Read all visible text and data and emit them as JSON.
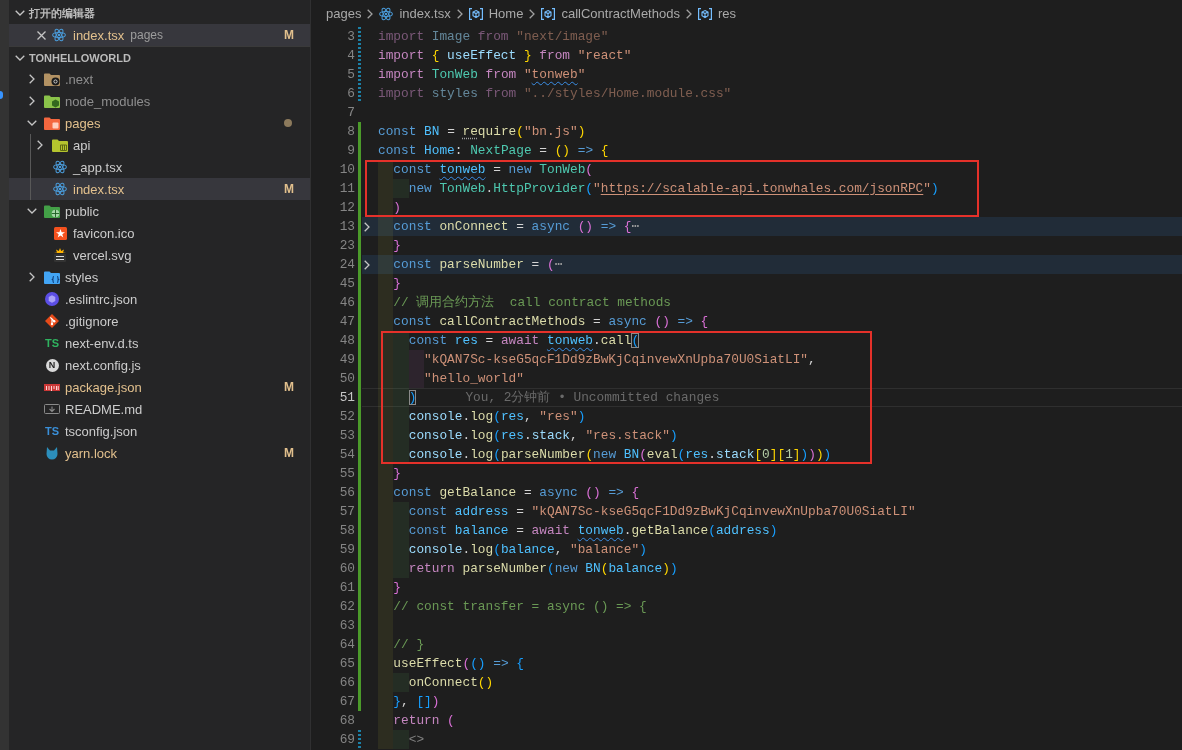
{
  "sidebar": {
    "open_editors": {
      "title": "打开的编辑器",
      "expanded": true,
      "items": [
        {
          "label": "index.tsx",
          "kind": "react",
          "folder": "pages",
          "modified": true,
          "badge": "M",
          "selected": true
        }
      ]
    },
    "explorer": {
      "title": "TONHELLOWORLD",
      "expanded": true,
      "items": [
        {
          "label": ".next",
          "kind": "folder-next",
          "expanded": false,
          "modified": false,
          "ignored": true,
          "changes_inside": false,
          "selected": false
        },
        {
          "label": "node_modules",
          "kind": "folder-node",
          "expanded": false,
          "modified": false,
          "ignored": true,
          "changes_inside": false,
          "selected": false
        },
        {
          "label": "pages",
          "kind": "folder-pages",
          "expanded": true,
          "modified": false,
          "ignored": false,
          "changes_inside": true,
          "selected": false,
          "children": [
            {
              "label": "api",
              "kind": "folder-api",
              "expanded": false,
              "modified": false,
              "ignored": false,
              "changes_inside": false,
              "selected": false
            },
            {
              "label": "_app.tsx",
              "kind": "react",
              "modified": false,
              "ignored": false,
              "selected": false
            },
            {
              "label": "index.tsx",
              "kind": "react",
              "modified": true,
              "ignored": false,
              "badge": "M",
              "selected": true
            }
          ]
        },
        {
          "label": "public",
          "kind": "folder-public",
          "expanded": true,
          "modified": false,
          "ignored": false,
          "changes_inside": false,
          "selected": false,
          "children": [
            {
              "label": "favicon.ico",
              "kind": "favicon",
              "modified": false,
              "ignored": false,
              "selected": false
            },
            {
              "label": "vercel.svg",
              "kind": "svg",
              "modified": false,
              "ignored": false,
              "selected": false
            }
          ]
        },
        {
          "label": "styles",
          "kind": "folder-styles",
          "expanded": false,
          "modified": false,
          "ignored": false,
          "changes_inside": false,
          "selected": false
        },
        {
          "label": ".eslintrc.json",
          "kind": "eslint",
          "modified": false,
          "ignored": false,
          "selected": false
        },
        {
          "label": ".gitignore",
          "kind": "git",
          "modified": false,
          "ignored": false,
          "selected": false
        },
        {
          "label": "next-env.d.ts",
          "kind": "ts",
          "icon_text": "TS",
          "modified": false,
          "ignored": false,
          "selected": false
        },
        {
          "label": "next.config.js",
          "kind": "next",
          "icon_text": "N",
          "modified": false,
          "ignored": false,
          "selected": false
        },
        {
          "label": "package.json",
          "kind": "npm",
          "modified": true,
          "ignored": false,
          "badge": "M",
          "selected": false
        },
        {
          "label": "README.md",
          "kind": "markdown",
          "modified": false,
          "ignored": false,
          "selected": false
        },
        {
          "label": "tsconfig.json",
          "kind": "tsconfig",
          "icon_text": "TS",
          "modified": false,
          "ignored": false,
          "selected": false
        },
        {
          "label": "yarn.lock",
          "kind": "yarn",
          "modified": true,
          "ignored": false,
          "badge": "M",
          "selected": false
        }
      ]
    }
  },
  "editor": {
    "breadcrumbs": [
      {
        "kind": "folder",
        "label": "pages"
      },
      {
        "kind": "react",
        "label": "index.tsx"
      },
      {
        "kind": "symbol",
        "label": "Home"
      },
      {
        "kind": "symbol",
        "label": "callContractMethods"
      },
      {
        "kind": "symbol",
        "label": "res"
      }
    ],
    "code": {
      "lines": [
        {
          "number": "3",
          "kind": "modified",
          "folded": false,
          "current": false,
          "faded": true,
          "boxed": false,
          "tokens": [
            {
              "kind": "keyword",
              "text": "import"
            },
            {
              "kind": "variable",
              "text": " Image"
            },
            {
              "kind": "keyword",
              "text": " from"
            },
            {
              "kind": "string",
              "text": " \"next/image\""
            }
          ]
        },
        {
          "number": "4",
          "kind": "modified",
          "folded": false,
          "current": false,
          "faded": false,
          "boxed": false,
          "tokens": [
            {
              "kind": "keyword",
              "text": "import"
            },
            {
              "kind": "bracket1",
              "text": " {"
            },
            {
              "kind": "variable",
              "text": " useEffect"
            },
            {
              "kind": "bracket1",
              "text": " }"
            },
            {
              "kind": "keyword",
              "text": " from"
            },
            {
              "kind": "string",
              "text": " \"react\""
            }
          ]
        },
        {
          "number": "5",
          "kind": "modified",
          "folded": false,
          "current": false,
          "faded": false,
          "boxed": false,
          "tokens": [
            {
              "kind": "keyword",
              "text": "import"
            },
            {
              "kind": "class",
              "text": " TonWeb"
            },
            {
              "kind": "keyword",
              "text": " from"
            },
            {
              "kind": "string",
              "text": " \""
            },
            {
              "kind": "string",
              "text": "tonweb",
              "squiggly": true
            },
            {
              "kind": "string",
              "text": "\""
            }
          ]
        },
        {
          "number": "6",
          "kind": "modified",
          "folded": false,
          "current": false,
          "faded": true,
          "boxed": false,
          "tokens": [
            {
              "kind": "keyword",
              "text": "import"
            },
            {
              "kind": "variable",
              "text": " styles"
            },
            {
              "kind": "keyword",
              "text": " from"
            },
            {
              "kind": "string",
              "text": " \"../styles/Home.module.css\""
            }
          ]
        },
        {
          "number": "7",
          "kind": "unchanged",
          "folded": false,
          "current": false,
          "boxed": false
        },
        {
          "number": "8",
          "kind": "added",
          "folded": false,
          "current": false,
          "faded": false,
          "boxed": false,
          "tokens": [
            {
              "kind": "storage",
              "text": "const"
            },
            {
              "kind": "constant",
              "text": " BN"
            },
            {
              "kind": "punct",
              "text": " = "
            },
            {
              "kind": "function",
              "text": "re",
              "hint": true
            },
            {
              "kind": "function",
              "text": "quire"
            },
            {
              "kind": "bracket1",
              "text": "("
            },
            {
              "kind": "string",
              "text": "\"bn.js\""
            },
            {
              "kind": "bracket1",
              "text": ")"
            }
          ]
        },
        {
          "number": "9",
          "kind": "added",
          "folded": false,
          "current": false,
          "faded": false,
          "boxed": false,
          "tokens": [
            {
              "kind": "storage",
              "text": "const"
            },
            {
              "kind": "constant",
              "text": " Home"
            },
            {
              "kind": "punct",
              "text": ":"
            },
            {
              "kind": "class",
              "text": " NextPage"
            },
            {
              "kind": "punct",
              "text": " = "
            },
            {
              "kind": "bracket1",
              "text": "("
            },
            {
              "kind": "bracket1",
              "text": ")"
            },
            {
              "kind": "storage",
              "text": " =>"
            },
            {
              "kind": "bracket1",
              "text": " {"
            }
          ],
          "children": [
            {
              "number": "10",
              "kind": "added",
              "folded": false,
              "current": false,
              "faded": false,
              "boxed": true,
              "tokens": [
                {
                  "kind": "storage",
                  "text": "const "
                },
                {
                  "kind": "constant",
                  "text": "tonweb",
                  "squiggly": true
                },
                {
                  "kind": "punct",
                  "text": " = "
                },
                {
                  "kind": "storage",
                  "text": "new"
                },
                {
                  "kind": "class",
                  "text": " TonWeb"
                },
                {
                  "kind": "bracket2",
                  "text": "("
                }
              ],
              "children": [
                {
                  "number": "11",
                  "kind": "added",
                  "folded": false,
                  "current": false,
                  "faded": false,
                  "boxed": true,
                  "tokens": [
                    {
                      "kind": "storage",
                      "text": "new"
                    },
                    {
                      "kind": "class",
                      "text": " TonWeb"
                    },
                    {
                      "kind": "punct",
                      "text": "."
                    },
                    {
                      "kind": "class",
                      "text": "HttpProvider"
                    },
                    {
                      "kind": "bracket3",
                      "text": "("
                    },
                    {
                      "kind": "string",
                      "text": "\""
                    },
                    {
                      "kind": "string",
                      "text": "https://scalable-api.tonwhales.com/jsonRPC",
                      "link": true
                    },
                    {
                      "kind": "string",
                      "text": "\""
                    },
                    {
                      "kind": "bracket3",
                      "text": ")"
                    }
                  ]
                }
              ]
            },
            {
              "number": "12",
              "kind": "added",
              "folded": false,
              "current": false,
              "faded": false,
              "boxed": true,
              "tokens": [
                {
                  "kind": "bracket2",
                  "text": ")"
                }
              ]
            },
            {
              "number": "13",
              "kind": "added",
              "folded": true,
              "current": false,
              "faded": false,
              "boxed": false,
              "tokens": [
                {
                  "kind": "storage",
                  "text": "const"
                },
                {
                  "kind": "function",
                  "text": " onConnect"
                },
                {
                  "kind": "punct",
                  "text": " = "
                },
                {
                  "kind": "storage",
                  "text": "async"
                },
                {
                  "kind": "bracket2",
                  "text": " ("
                },
                {
                  "kind": "bracket2",
                  "text": ")"
                },
                {
                  "kind": "storage",
                  "text": " =>"
                },
                {
                  "kind": "bracket2",
                  "text": " {"
                },
                {
                  "kind": "fold",
                  "text": "⋯"
                }
              ]
            },
            {
              "number": "23",
              "kind": "added",
              "folded": false,
              "current": false,
              "faded": false,
              "boxed": false,
              "tokens": [
                {
                  "kind": "bracket2",
                  "text": "}"
                }
              ]
            },
            {
              "number": "24",
              "kind": "added",
              "folded": true,
              "current": false,
              "faded": false,
              "boxed": false,
              "tokens": [
                {
                  "kind": "storage",
                  "text": "const"
                },
                {
                  "kind": "function",
                  "text": " parseNumber"
                },
                {
                  "kind": "punct",
                  "text": " = "
                },
                {
                  "kind": "bracket2",
                  "text": "("
                },
                {
                  "kind": "fold",
                  "text": "⋯"
                }
              ]
            },
            {
              "number": "45",
              "kind": "added",
              "folded": false,
              "current": false,
              "faded": false,
              "boxed": false,
              "tokens": [
                {
                  "kind": "bracket2",
                  "text": "}"
                }
              ]
            },
            {
              "number": "46",
              "kind": "added",
              "folded": false,
              "current": false,
              "faded": false,
              "boxed": false,
              "tokens": [
                {
                  "kind": "comment",
                  "text": "// 调用合约方法  call contract methods"
                }
              ]
            },
            {
              "number": "47",
              "kind": "added",
              "folded": false,
              "current": false,
              "faded": false,
              "boxed": false,
              "tokens": [
                {
                  "kind": "storage",
                  "text": "const"
                },
                {
                  "kind": "function",
                  "text": " callContractMethods"
                },
                {
                  "kind": "punct",
                  "text": " = "
                },
                {
                  "kind": "storage",
                  "text": "async"
                },
                {
                  "kind": "bracket2",
                  "text": " ("
                },
                {
                  "kind": "bracket2",
                  "text": ")"
                },
                {
                  "kind": "storage",
                  "text": " =>"
                },
                {
                  "kind": "bracket2",
                  "text": " {"
                }
              ],
              "children": [
                {
                  "number": "48",
                  "kind": "added",
                  "folded": false,
                  "current": false,
                  "faded": false,
                  "boxed": true,
                  "tokens": [
                    {
                      "kind": "storage",
                      "text": "const "
                    },
                    {
                      "kind": "constant",
                      "text": "res"
                    },
                    {
                      "kind": "punct",
                      "text": " = "
                    },
                    {
                      "kind": "keyword",
                      "text": "await "
                    },
                    {
                      "kind": "constant",
                      "text": "tonweb",
                      "squiggly": true
                    },
                    {
                      "kind": "punct",
                      "text": "."
                    },
                    {
                      "kind": "function",
                      "text": "call"
                    },
                    {
                      "kind": "bracket3",
                      "text": "(",
                      "matched": true
                    }
                  ],
                  "children": [
                    {
                      "number": "49",
                      "kind": "added",
                      "folded": false,
                      "current": false,
                      "faded": false,
                      "boxed": true,
                      "tokens": [
                        {
                          "kind": "string",
                          "text": "\"kQAN7Sc-kseG5qcF1Dd9zBwKjCqinvewXnUpba70U0SiatLI\""
                        },
                        {
                          "kind": "punct",
                          "text": ","
                        }
                      ]
                    },
                    {
                      "number": "50",
                      "kind": "added",
                      "folded": false,
                      "current": false,
                      "faded": false,
                      "boxed": true,
                      "tokens": [
                        {
                          "kind": "string",
                          "text": "\"hello_world\""
                        }
                      ]
                    }
                  ]
                },
                {
                  "number": "51",
                  "kind": "added",
                  "folded": false,
                  "current": true,
                  "faded": false,
                  "boxed": true,
                  "blame": "You, 2分钟前 • Uncommitted changes",
                  "tokens": [
                    {
                      "kind": "bracket3",
                      "text": ")",
                      "matched": true
                    }
                  ]
                },
                {
                  "number": "52",
                  "kind": "added",
                  "folded": false,
                  "current": false,
                  "faded": false,
                  "boxed": true,
                  "tokens": [
                    {
                      "kind": "variable",
                      "text": "console"
                    },
                    {
                      "kind": "punct",
                      "text": "."
                    },
                    {
                      "kind": "function",
                      "text": "log"
                    },
                    {
                      "kind": "bracket3",
                      "text": "("
                    },
                    {
                      "kind": "constant",
                      "text": "res"
                    },
                    {
                      "kind": "punct",
                      "text": ", "
                    },
                    {
                      "kind": "string",
                      "text": "\"res\""
                    },
                    {
                      "kind": "bracket3",
                      "text": ")"
                    }
                  ]
                },
                {
                  "number": "53",
                  "kind": "added",
                  "folded": false,
                  "current": false,
                  "faded": false,
                  "boxed": true,
                  "tokens": [
                    {
                      "kind": "variable",
                      "text": "console"
                    },
                    {
                      "kind": "punct",
                      "text": "."
                    },
                    {
                      "kind": "function",
                      "text": "log"
                    },
                    {
                      "kind": "bracket3",
                      "text": "("
                    },
                    {
                      "kind": "constant",
                      "text": "res"
                    },
                    {
                      "kind": "punct",
                      "text": "."
                    },
                    {
                      "kind": "variable",
                      "text": "stack"
                    },
                    {
                      "kind": "punct",
                      "text": ", "
                    },
                    {
                      "kind": "string",
                      "text": "\"res.stack\""
                    },
                    {
                      "kind": "bracket3",
                      "text": ")"
                    }
                  ]
                },
                {
                  "number": "54",
                  "kind": "added",
                  "folded": false,
                  "current": false,
                  "faded": false,
                  "boxed": true,
                  "tokens": [
                    {
                      "kind": "variable",
                      "text": "console"
                    },
                    {
                      "kind": "punct",
                      "text": "."
                    },
                    {
                      "kind": "function",
                      "text": "log"
                    },
                    {
                      "kind": "bracket3",
                      "text": "("
                    },
                    {
                      "kind": "function",
                      "text": "parseNumber"
                    },
                    {
                      "kind": "bracket1",
                      "text": "("
                    },
                    {
                      "kind": "storage",
                      "text": "new"
                    },
                    {
                      "kind": "constant",
                      "text": " BN"
                    },
                    {
                      "kind": "bracket2",
                      "text": "("
                    },
                    {
                      "kind": "function",
                      "text": "eval"
                    },
                    {
                      "kind": "bracket3",
                      "text": "("
                    },
                    {
                      "kind": "constant",
                      "text": "res"
                    },
                    {
                      "kind": "punct",
                      "text": "."
                    },
                    {
                      "kind": "variable",
                      "text": "stack"
                    },
                    {
                      "kind": "bracket1",
                      "text": "["
                    },
                    {
                      "kind": "number",
                      "text": "0"
                    },
                    {
                      "kind": "bracket1",
                      "text": "]"
                    },
                    {
                      "kind": "bracket1",
                      "text": "["
                    },
                    {
                      "kind": "number",
                      "text": "1"
                    },
                    {
                      "kind": "bracket1",
                      "text": "]"
                    },
                    {
                      "kind": "bracket3",
                      "text": ")"
                    },
                    {
                      "kind": "bracket2",
                      "text": ")"
                    },
                    {
                      "kind": "bracket1",
                      "text": ")"
                    },
                    {
                      "kind": "bracket3",
                      "text": ")"
                    }
                  ]
                }
              ]
            },
            {
              "number": "55",
              "kind": "added",
              "folded": false,
              "current": false,
              "faded": false,
              "boxed": false,
              "tokens": [
                {
                  "kind": "bracket2",
                  "text": "}"
                }
              ]
            },
            {
              "number": "56",
              "kind": "added",
              "folded": false,
              "current": false,
              "faded": false,
              "boxed": false,
              "tokens": [
                {
                  "kind": "storage",
                  "text": "const"
                },
                {
                  "kind": "function",
                  "text": " getBalance"
                },
                {
                  "kind": "punct",
                  "text": " = "
                },
                {
                  "kind": "storage",
                  "text": "async"
                },
                {
                  "kind": "bracket2",
                  "text": " ("
                },
                {
                  "kind": "bracket2",
                  "text": ")"
                },
                {
                  "kind": "storage",
                  "text": " =>"
                },
                {
                  "kind": "bracket2",
                  "text": " {"
                }
              ],
              "children": [
                {
                  "number": "57",
                  "kind": "added",
                  "folded": false,
                  "current": false,
                  "faded": false,
                  "boxed": false,
                  "tokens": [
                    {
                      "kind": "storage",
                      "text": "const"
                    },
                    {
                      "kind": "constant",
                      "text": " address"
                    },
                    {
                      "kind": "punct",
                      "text": " = "
                    },
                    {
                      "kind": "string",
                      "text": "\"kQAN7Sc-kseG5qcF1Dd9zBwKjCqinvewXnUpba70U0SiatLI\""
                    }
                  ]
                },
                {
                  "number": "58",
                  "kind": "added",
                  "folded": false,
                  "current": false,
                  "faded": false,
                  "boxed": false,
                  "tokens": [
                    {
                      "kind": "storage",
                      "text": "const"
                    },
                    {
                      "kind": "constant",
                      "text": " balance"
                    },
                    {
                      "kind": "punct",
                      "text": " = "
                    },
                    {
                      "kind": "keyword",
                      "text": "await "
                    },
                    {
                      "kind": "constant",
                      "text": "tonweb",
                      "squiggly": true
                    },
                    {
                      "kind": "punct",
                      "text": "."
                    },
                    {
                      "kind": "function",
                      "text": "getBalance"
                    },
                    {
                      "kind": "bracket3",
                      "text": "("
                    },
                    {
                      "kind": "constant",
                      "text": "address"
                    },
                    {
                      "kind": "bracket3",
                      "text": ")"
                    }
                  ]
                },
                {
                  "number": "59",
                  "kind": "added",
                  "folded": false,
                  "current": false,
                  "faded": false,
                  "boxed": false,
                  "tokens": [
                    {
                      "kind": "variable",
                      "text": "console"
                    },
                    {
                      "kind": "punct",
                      "text": "."
                    },
                    {
                      "kind": "function",
                      "text": "log"
                    },
                    {
                      "kind": "bracket3",
                      "text": "("
                    },
                    {
                      "kind": "constant",
                      "text": "balance"
                    },
                    {
                      "kind": "punct",
                      "text": ", "
                    },
                    {
                      "kind": "string",
                      "text": "\"balance\""
                    },
                    {
                      "kind": "bracket3",
                      "text": ")"
                    }
                  ]
                },
                {
                  "number": "60",
                  "kind": "added",
                  "folded": false,
                  "current": false,
                  "faded": false,
                  "boxed": false,
                  "tokens": [
                    {
                      "kind": "keyword",
                      "text": "return "
                    },
                    {
                      "kind": "function",
                      "text": "parseNumber"
                    },
                    {
                      "kind": "bracket3",
                      "text": "("
                    },
                    {
                      "kind": "storage",
                      "text": "new"
                    },
                    {
                      "kind": "constant",
                      "text": " BN"
                    },
                    {
                      "kind": "bracket1",
                      "text": "("
                    },
                    {
                      "kind": "constant",
                      "text": "balance"
                    },
                    {
                      "kind": "bracket1",
                      "text": ")"
                    },
                    {
                      "kind": "bracket3",
                      "text": ")"
                    }
                  ]
                }
              ]
            },
            {
              "number": "61",
              "kind": "added",
              "folded": false,
              "current": false,
              "faded": false,
              "boxed": false,
              "tokens": [
                {
                  "kind": "bracket2",
                  "text": "}"
                }
              ]
            },
            {
              "number": "62",
              "kind": "added",
              "folded": false,
              "current": false,
              "faded": false,
              "boxed": false,
              "tokens": [
                {
                  "kind": "comment",
                  "text": "// const transfer = async () => {"
                }
              ]
            },
            {
              "number": "63",
              "kind": "added",
              "folded": false,
              "current": false,
              "boxed": false
            },
            {
              "number": "64",
              "kind": "added",
              "folded": false,
              "current": false,
              "faded": false,
              "boxed": false,
              "tokens": [
                {
                  "kind": "comment",
                  "text": "// }"
                }
              ]
            },
            {
              "number": "65",
              "kind": "added",
              "folded": false,
              "current": false,
              "faded": false,
              "boxed": false,
              "tokens": [
                {
                  "kind": "function",
                  "text": "useEffect"
                },
                {
                  "kind": "bracket2",
                  "text": "("
                },
                {
                  "kind": "bracket3",
                  "text": "("
                },
                {
                  "kind": "bracket3",
                  "text": ")"
                },
                {
                  "kind": "storage",
                  "text": " =>"
                },
                {
                  "kind": "bracket3",
                  "text": " {"
                }
              ],
              "children": [
                {
                  "number": "66",
                  "kind": "added",
                  "folded": false,
                  "current": false,
                  "faded": false,
                  "boxed": false,
                  "tokens": [
                    {
                      "kind": "function",
                      "text": "onConnect"
                    },
                    {
                      "kind": "bracket1",
                      "text": "("
                    },
                    {
                      "kind": "bracket1",
                      "text": ")"
                    }
                  ]
                }
              ]
            },
            {
              "number": "67",
              "kind": "added",
              "folded": false,
              "current": false,
              "faded": false,
              "boxed": false,
              "tokens": [
                {
                  "kind": "bracket3",
                  "text": "}"
                },
                {
                  "kind": "punct",
                  "text": ","
                },
                {
                  "kind": "bracket3",
                  "text": " ["
                },
                {
                  "kind": "bracket3",
                  "text": "]"
                },
                {
                  "kind": "bracket2",
                  "text": ")"
                }
              ]
            },
            {
              "number": "68",
              "kind": "unchanged",
              "folded": false,
              "current": false,
              "faded": false,
              "boxed": false,
              "tokens": [
                {
                  "kind": "keyword",
                  "text": "return"
                },
                {
                  "kind": "bracket2",
                  "text": " ("
                }
              ],
              "children": [
                {
                  "number": "69",
                  "kind": "modified",
                  "folded": false,
                  "current": false,
                  "faded": false,
                  "boxed": false,
                  "tokens": [
                    {
                      "kind": "tag",
                      "text": "<>"
                    }
                  ]
                }
              ]
            }
          ]
        }
      ]
    }
  }
}
